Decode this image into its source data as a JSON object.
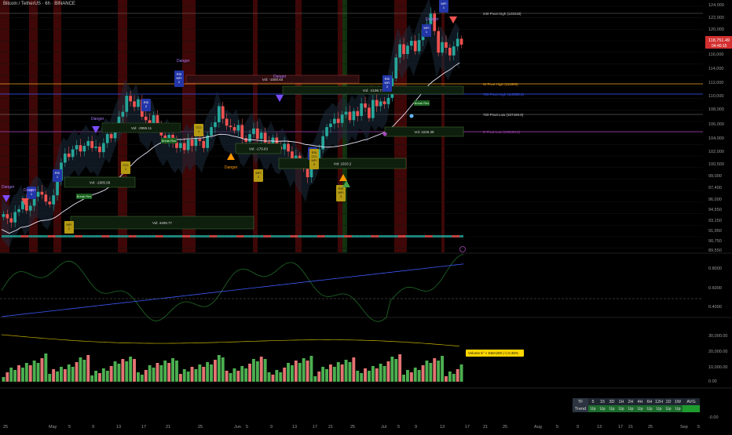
{
  "header": {
    "title": "Bitcoin / TetherUS · 6h · BINANCE"
  },
  "colors": {
    "up": "#26a69a",
    "down": "#ef5350",
    "yellow_line": "#c8b400",
    "blue_line": "#3d5afe",
    "green_line": "#2e7d32",
    "price_badge": "#d32f2f"
  },
  "price_axis": {
    "labels": [
      "124,000",
      "122,000",
      "120,000",
      "118,751.49",
      "04:40:15",
      "116,000",
      "114,000",
      "112,000",
      "110,000",
      "108,000",
      "106,000",
      "104,000",
      "102,000",
      "100,500",
      "99,000",
      "97,400",
      "96,000",
      "94,550",
      "93,150",
      "91,950",
      "90,750",
      "89,550"
    ],
    "current_price": "118,751.49",
    "countdown": "04:40:15"
  },
  "pivot_labels": [
    {
      "text": "240 Pivot High (123218)",
      "color": "#cccccc"
    },
    {
      "text": "W Pivot High (111980)",
      "color": "#f5a623"
    },
    {
      "text": "720 Pivot High (110529.2)",
      "color": "#3d5afe"
    },
    {
      "text": "720 Pivot Low (107429.6)",
      "color": "#cccccc"
    },
    {
      "text": "D Pivot Low (105100.2)",
      "color": "#ab47bc"
    }
  ],
  "signals": [
    {
      "kind": "rsi",
      "text": "RSI 1"
    },
    {
      "kind": "rsi",
      "text": "MFI 1"
    },
    {
      "kind": "rsi",
      "text": "RSI 2"
    },
    {
      "kind": "rsi",
      "text": "RSI MFI 2"
    },
    {
      "kind": "rsi",
      "text": "RSI 3"
    },
    {
      "kind": "rsi",
      "text": "RSI MFI 2"
    },
    {
      "kind": "rsi",
      "text": "MFI 1"
    },
    {
      "kind": "rsi",
      "text": "MFI 1"
    },
    {
      "kind": "cci",
      "text": "MFI 1"
    },
    {
      "kind": "cci",
      "text": "CCI 1"
    },
    {
      "kind": "cci",
      "text": "CCI 1"
    },
    {
      "kind": "cci",
      "text": "MFI 1"
    },
    {
      "kind": "cci",
      "text": "RSI CCI MFI 3"
    },
    {
      "kind": "cci",
      "text": "RSI MFI 3"
    }
  ],
  "danger_labels": [
    "Danger",
    "Danger",
    "Danger",
    "Danger",
    "Danger",
    "Danger",
    "Danger"
  ],
  "vol_boxes": [
    {
      "text": "Vol: -1905.69"
    },
    {
      "text": "Vol: 4409.77"
    },
    {
      "text": "Vol: -1500.64"
    },
    {
      "text": "Vol: -2196.77"
    },
    {
      "text": "Vol: -179.63"
    },
    {
      "text": "Vol: 1910.2"
    },
    {
      "text": "Vol: 2225.39"
    },
    {
      "text": "Vol: -2955.11"
    }
  ],
  "break_labels": [
    "Break Res",
    "Break Res",
    "Break Res"
  ],
  "osc_axis": {
    "labels": [
      "0.8000",
      "0.6000",
      "0.4000"
    ]
  },
  "vol_axis": {
    "labels": [
      "30,000.00",
      "20,000.00",
      "10,000.00",
      "0.00",
      "-0.00"
    ]
  },
  "volume_badge": {
    "text": "Volume 5° × EMA200 (+) 0.35%"
  },
  "time_axis": {
    "labels": [
      "25",
      "May",
      "5",
      "9",
      "13",
      "17",
      "21",
      "25",
      "Jun",
      "5",
      "9",
      "13",
      "17",
      "21",
      "25",
      "Jul",
      "5",
      "9",
      "13",
      "17",
      "21",
      "25",
      "Aug",
      "5",
      "9",
      "13",
      "17",
      "21",
      "25",
      "Sep",
      "5"
    ]
  },
  "trend_table": {
    "head": "TF",
    "tfs": [
      "5",
      "15",
      "3D",
      "1H",
      "2H",
      "4H",
      "6H",
      "12H",
      "1D",
      "1W",
      "AVG"
    ],
    "row_label": "Trend",
    "values": [
      "Up",
      "Up",
      "Up",
      "Up",
      "Up",
      "Up",
      "Up",
      "Up",
      "Up",
      "Up",
      ""
    ]
  },
  "chart_data": {
    "type": "candlestick",
    "series_note": "",
    "close": [
      94400,
      93800,
      93200,
      94700,
      95100,
      96300,
      94900,
      95600,
      96900,
      97600,
      97200,
      96200,
      95800,
      97100,
      99200,
      101800,
      103100,
      102600,
      103700,
      104300,
      103400,
      104200,
      104900,
      103900,
      104100,
      103300,
      104600,
      105900,
      105300,
      106800,
      108400,
      109100,
      111400,
      110600,
      109800,
      110900,
      108400,
      107900,
      107200,
      108600,
      106900,
      105700,
      104900,
      105800,
      104700,
      103900,
      104600,
      103600,
      105100,
      104200,
      105200,
      104900,
      103900,
      105700,
      106900,
      107600,
      109900,
      108100,
      107100,
      106900,
      106400,
      107200,
      105300,
      104800,
      105900,
      106700,
      105200,
      106100,
      104700,
      104300,
      105400,
      104100,
      103700,
      104500,
      103400,
      101800,
      102800,
      101500,
      100900,
      99700,
      102100,
      102400,
      103700,
      105600,
      106900,
      107400,
      108100,
      107500,
      108700,
      109100,
      107900,
      109200,
      108500,
      110300,
      109700,
      108200,
      110800,
      109900,
      110600,
      110200,
      111100,
      113900,
      116900,
      118800,
      117400,
      118600,
      119300,
      117800,
      119400,
      120900,
      121700,
      123200,
      120700,
      117600,
      119100,
      118300,
      117200,
      118500,
      119600,
      118751
    ]
  }
}
